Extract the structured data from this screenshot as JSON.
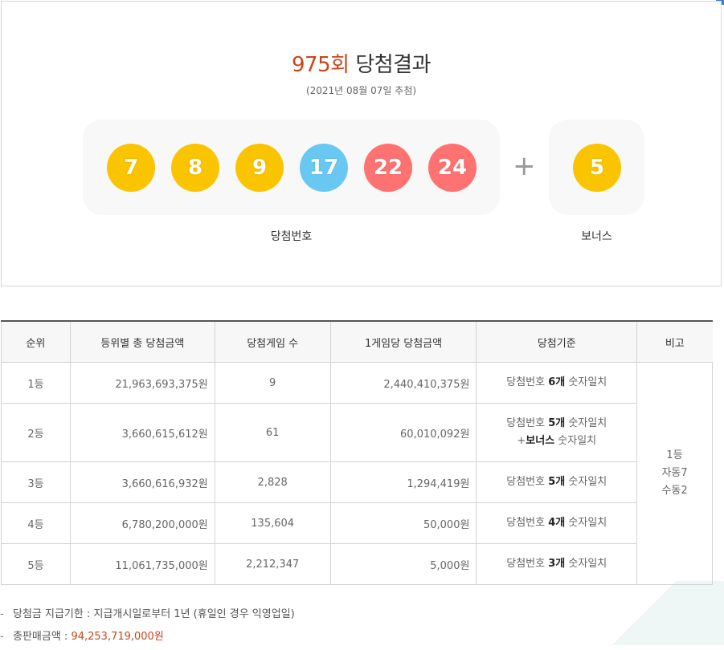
{
  "header": {
    "round": "975회",
    "title": "당첨결과",
    "draw_date": "(2021년 08월 07일 추첨)"
  },
  "winning_numbers": [
    {
      "number": "7",
      "color": "#fbc400"
    },
    {
      "number": "8",
      "color": "#fbc400"
    },
    {
      "number": "9",
      "color": "#fbc400"
    },
    {
      "number": "17",
      "color": "#69c8f2"
    },
    {
      "number": "22",
      "color": "#ff7272"
    },
    {
      "number": "24",
      "color": "#ff7272"
    }
  ],
  "plus_symbol": "+",
  "bonus": {
    "number": "5",
    "color": "#fbc400"
  },
  "labels": {
    "winning": "당첨번호",
    "bonus": "보너스"
  },
  "table": {
    "headers": [
      "순위",
      "등위별 총 당첨금액",
      "당첨게임 수",
      "1게임당 당첨금액",
      "당첨기준",
      "비고"
    ],
    "rows": [
      {
        "rank": "1등",
        "total": "21,963,693,375원",
        "count": "9",
        "per_game": "2,440,410,375원",
        "criteria_pre": "당첨번호 ",
        "criteria_bold": "6개",
        "criteria_post": " 숫자일치"
      },
      {
        "rank": "2등",
        "total": "3,660,615,612원",
        "count": "61",
        "per_game": "60,010,092원",
        "criteria_pre": "당첨번호 ",
        "criteria_bold": "5개",
        "criteria_post": " 숫자일치",
        "criteria_line2_pre": "+",
        "criteria_line2_bold": "보너스",
        "criteria_line2_post": " 숫자일치"
      },
      {
        "rank": "3등",
        "total": "3,660,616,932원",
        "count": "2,828",
        "per_game": "1,294,419원",
        "criteria_pre": "당첨번호 ",
        "criteria_bold": "5개",
        "criteria_post": " 숫자일치"
      },
      {
        "rank": "4등",
        "total": "6,780,200,000원",
        "count": "135,604",
        "per_game": "50,000원",
        "criteria_pre": "당첨번호 ",
        "criteria_bold": "4개",
        "criteria_post": " 숫자일치"
      },
      {
        "rank": "5등",
        "total": "11,061,735,000원",
        "count": "2,212,347",
        "per_game": "5,000원",
        "criteria_pre": "당첨번호 ",
        "criteria_bold": "3개",
        "criteria_post": " 숫자일치"
      }
    ],
    "remarks": [
      "1등",
      "자동7",
      "수동2"
    ]
  },
  "notes": {
    "deadline_label": "당첨금 지급기한 : 지급개시일로부터 1년 (휴일인 경우 익영업일)",
    "sales_label": "총판매금액 : ",
    "sales_value": "94,253,719,000원",
    "dash": "-"
  }
}
